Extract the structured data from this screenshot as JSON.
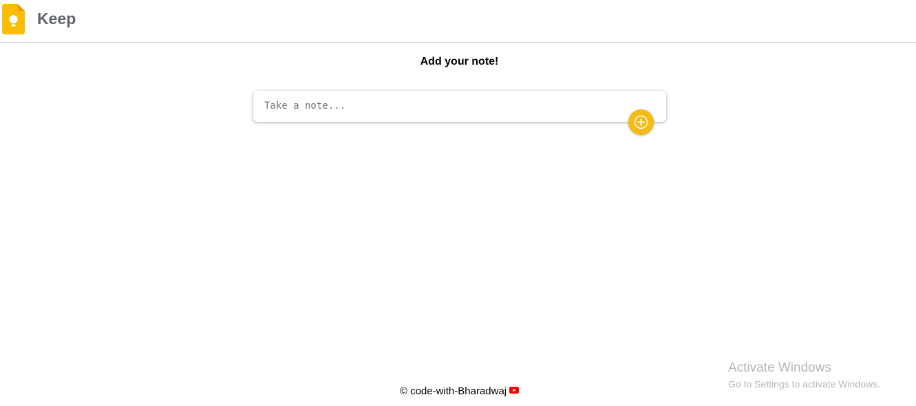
{
  "header": {
    "app_title": "Keep",
    "logo_icon": "keep-lightbulb-icon",
    "brand_color": "#fbbc04"
  },
  "main": {
    "heading": "Add your note!",
    "note_input": {
      "placeholder": "Take a note...",
      "value": ""
    },
    "add_button": {
      "icon": "plus-icon",
      "color": "#f5ba13"
    }
  },
  "footer": {
    "text": "© code-with-Bharadwaj",
    "icon": "youtube-icon",
    "icon_color": "#ff0000"
  },
  "system_watermark": {
    "title": "Activate Windows",
    "subtitle": "Go to Settings to activate Windows."
  }
}
